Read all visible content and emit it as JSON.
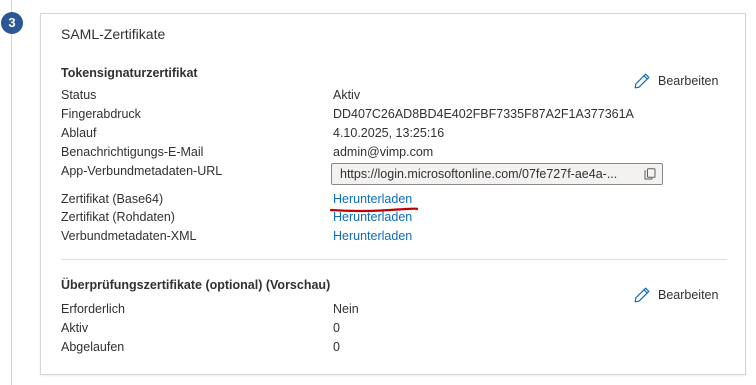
{
  "step": {
    "number": "3"
  },
  "card": {
    "title": "SAML-Zertifikate"
  },
  "token_section": {
    "heading": "Tokensignaturzertifikat",
    "edit_label": "Bearbeiten",
    "rows": [
      {
        "label": "Status",
        "value": "Aktiv"
      },
      {
        "label": "Fingerabdruck",
        "value": "DD407C26AD8BD4E402FBF7335F87A2F1A377361A"
      },
      {
        "label": "Ablauf",
        "value": "4.10.2025, 13:25:16"
      },
      {
        "label": "Benachrichtigungs-E-Mail",
        "value": "admin@vimp.com"
      },
      {
        "label": "App-Verbundmetadaten-URL",
        "value": "https://login.microsoftonline.com/07fe727f-ae4a-..."
      },
      {
        "label": "Zertifikat (Base64)",
        "value": "Herunterladen"
      },
      {
        "label": "Zertifikat (Rohdaten)",
        "value": "Herunterladen"
      },
      {
        "label": "Verbundmetadaten-XML",
        "value": "Herunterladen"
      }
    ]
  },
  "verification_section": {
    "heading": "Überprüfungszertifikate (optional) (Vorschau)",
    "edit_label": "Bearbeiten",
    "rows": [
      {
        "label": "Erforderlich",
        "value": "Nein"
      },
      {
        "label": "Aktiv",
        "value": "0"
      },
      {
        "label": "Abgelaufen",
        "value": "0"
      }
    ]
  },
  "colors": {
    "accent": "#0f6cbd",
    "badge": "#2b5797",
    "annotation": "#c00000"
  },
  "icons": {
    "edit": "pencil-icon",
    "copy": "copy-icon"
  }
}
